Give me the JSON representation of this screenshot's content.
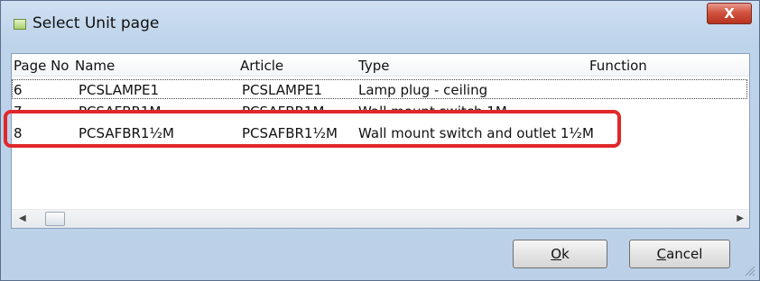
{
  "window": {
    "title": "Select Unit page",
    "close_label": "X"
  },
  "list": {
    "columns": [
      "Page No",
      "Name",
      "Article",
      "Type",
      "Function"
    ],
    "rows": [
      {
        "page": "6",
        "name": "PCSLAMPE1",
        "article": "PCSLAMPE1",
        "type": "Lamp plug - ceiling",
        "function": ""
      },
      {
        "page": "7",
        "name": "PCSAFBR1M",
        "article": "PCSAFBR1M",
        "type": "Wall mount switch 1M",
        "function": ""
      },
      {
        "page": "8",
        "name": "PCSAFBR1½M",
        "article": "PCSAFBR1½M",
        "type": "Wall mount switch and outlet 1½M",
        "function": ""
      }
    ]
  },
  "buttons": {
    "ok_u": "O",
    "ok_rest": "k",
    "cancel_u": "C",
    "cancel_rest": "ancel"
  },
  "colors": {
    "highlight": "#e0282a",
    "title_bar": "#bdd3ea",
    "close_button": "#c8442f"
  }
}
